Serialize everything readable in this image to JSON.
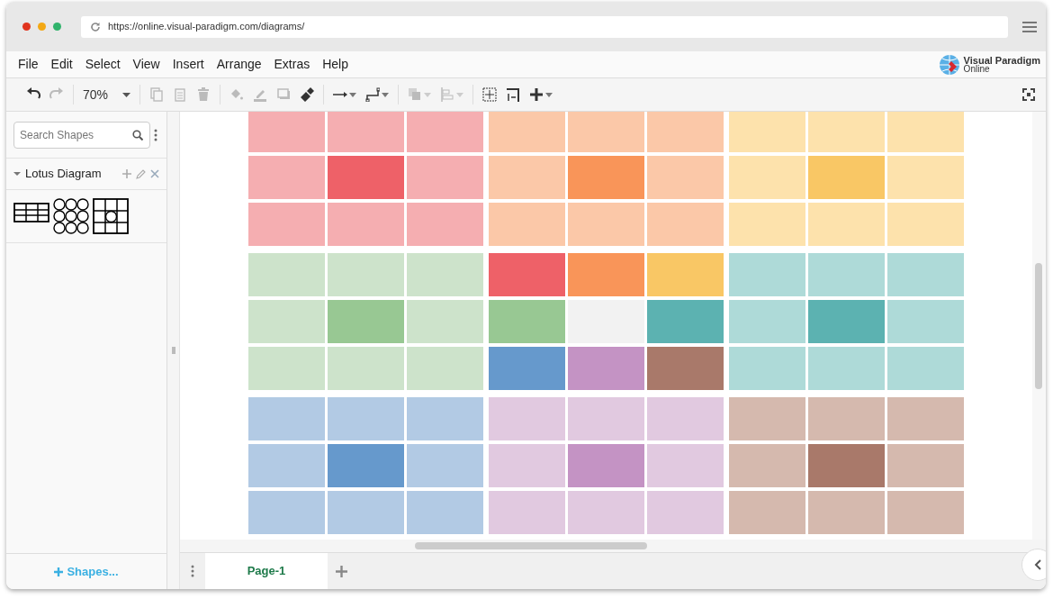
{
  "browser": {
    "url": "https://online.visual-paradigm.com/diagrams/"
  },
  "menu": [
    "File",
    "Edit",
    "Select",
    "View",
    "Insert",
    "Arrange",
    "Extras",
    "Help"
  ],
  "logo": {
    "line_1": "Visual Paradigm",
    "line_2": "Online"
  },
  "toolbar": {
    "zoom": "70%",
    "tool_groups": [
      [
        {
          "kind": "undo",
          "disabled": false,
          "dropdown": false
        },
        {
          "kind": "redo",
          "disabled": true,
          "dropdown": false
        }
      ],
      [
        {
          "kind": "copy",
          "disabled": true,
          "dropdown": false
        },
        {
          "kind": "paste",
          "disabled": true,
          "dropdown": false
        },
        {
          "kind": "delete",
          "disabled": true,
          "dropdown": false
        }
      ],
      [
        {
          "kind": "fill",
          "disabled": true,
          "dropdown": false
        },
        {
          "kind": "line-color",
          "disabled": true,
          "dropdown": false
        },
        {
          "kind": "shadow",
          "disabled": true,
          "dropdown": false
        },
        {
          "kind": "format-painter",
          "disabled": false,
          "dropdown": false
        }
      ],
      [
        {
          "kind": "connector",
          "disabled": false,
          "dropdown": true
        },
        {
          "kind": "waypoint",
          "disabled": false,
          "dropdown": true
        }
      ],
      [
        {
          "kind": "to-front",
          "disabled": true,
          "dropdown": true
        },
        {
          "kind": "align",
          "disabled": true,
          "dropdown": true
        }
      ],
      [
        {
          "kind": "fit",
          "disabled": false,
          "dropdown": false
        },
        {
          "kind": "page-size",
          "disabled": false,
          "dropdown": false
        },
        {
          "kind": "insert",
          "disabled": false,
          "dropdown": true
        }
      ]
    ]
  },
  "sidebar": {
    "search": {
      "placeholder": "Search Shapes"
    },
    "section": {
      "title": "Lotus Diagram",
      "expanded": true
    },
    "shapes": [
      {
        "kind": "table-grid"
      },
      {
        "kind": "circle-grid"
      },
      {
        "kind": "circle-center-grid"
      }
    ],
    "more_shapes": "Shapes..."
  },
  "diagram": {
    "blocks": [
      {
        "cells": [
          {
            "color": "#f5aeb1"
          },
          {
            "color": "#f5aeb1"
          },
          {
            "color": "#f5aeb1"
          },
          {
            "color": "#f5aeb1"
          },
          {
            "color": "#ee6168"
          },
          {
            "color": "#f5aeb1"
          },
          {
            "color": "#f5aeb1"
          },
          {
            "color": "#f5aeb1"
          },
          {
            "color": "#f5aeb1"
          }
        ]
      },
      {
        "cells": [
          {
            "color": "#fbc8a8"
          },
          {
            "color": "#fbc8a8"
          },
          {
            "color": "#fbc8a8"
          },
          {
            "color": "#fbc8a8"
          },
          {
            "color": "#f99559"
          },
          {
            "color": "#fbc8a8"
          },
          {
            "color": "#fbc8a8"
          },
          {
            "color": "#fbc8a8"
          },
          {
            "color": "#fbc8a8"
          }
        ]
      },
      {
        "cells": [
          {
            "color": "#fde2ac"
          },
          {
            "color": "#fde2ac"
          },
          {
            "color": "#fde2ac"
          },
          {
            "color": "#fde2ac"
          },
          {
            "color": "#f9c765"
          },
          {
            "color": "#fde2ac"
          },
          {
            "color": "#fde2ac"
          },
          {
            "color": "#fde2ac"
          },
          {
            "color": "#fde2ac"
          }
        ]
      },
      {
        "cells": [
          {
            "color": "#cde3cb"
          },
          {
            "color": "#cde3cb"
          },
          {
            "color": "#cde3cb"
          },
          {
            "color": "#cde3cb"
          },
          {
            "color": "#98c893"
          },
          {
            "color": "#cde3cb"
          },
          {
            "color": "#cde3cb"
          },
          {
            "color": "#cde3cb"
          },
          {
            "color": "#cde3cb"
          }
        ]
      },
      {
        "cells": [
          {
            "color": "#ee6168"
          },
          {
            "color": "#f99559"
          },
          {
            "color": "#f9c765"
          },
          {
            "color": "#98c893"
          },
          {
            "color": "#f2f2f2"
          },
          {
            "color": "#5cb2b1"
          },
          {
            "color": "#6699cc"
          },
          {
            "color": "#c493c4"
          },
          {
            "color": "#a9796a"
          }
        ]
      },
      {
        "cells": [
          {
            "color": "#aedad8"
          },
          {
            "color": "#aedad8"
          },
          {
            "color": "#aedad8"
          },
          {
            "color": "#aedad8"
          },
          {
            "color": "#5cb2b1"
          },
          {
            "color": "#aedad8"
          },
          {
            "color": "#aedad8"
          },
          {
            "color": "#aedad8"
          },
          {
            "color": "#aedad8"
          }
        ]
      },
      {
        "cells": [
          {
            "color": "#b2cae4"
          },
          {
            "color": "#b2cae4"
          },
          {
            "color": "#b2cae4"
          },
          {
            "color": "#b2cae4"
          },
          {
            "color": "#6699cc"
          },
          {
            "color": "#b2cae4"
          },
          {
            "color": "#b2cae4"
          },
          {
            "color": "#b2cae4"
          },
          {
            "color": "#b2cae4"
          }
        ]
      },
      {
        "cells": [
          {
            "color": "#e1c9e0"
          },
          {
            "color": "#e1c9e0"
          },
          {
            "color": "#e1c9e0"
          },
          {
            "color": "#e1c9e0"
          },
          {
            "color": "#c493c4"
          },
          {
            "color": "#e1c9e0"
          },
          {
            "color": "#e1c9e0"
          },
          {
            "color": "#e1c9e0"
          },
          {
            "color": "#e1c9e0"
          }
        ]
      },
      {
        "cells": [
          {
            "color": "#d5b9ae"
          },
          {
            "color": "#d5b9ae"
          },
          {
            "color": "#d5b9ae"
          },
          {
            "color": "#d5b9ae"
          },
          {
            "color": "#a9796a"
          },
          {
            "color": "#d5b9ae"
          },
          {
            "color": "#d5b9ae"
          },
          {
            "color": "#d5b9ae"
          },
          {
            "color": "#d5b9ae"
          }
        ]
      }
    ]
  },
  "pages": {
    "tabs": [
      {
        "label": "Page-1",
        "selected": true
      }
    ]
  }
}
